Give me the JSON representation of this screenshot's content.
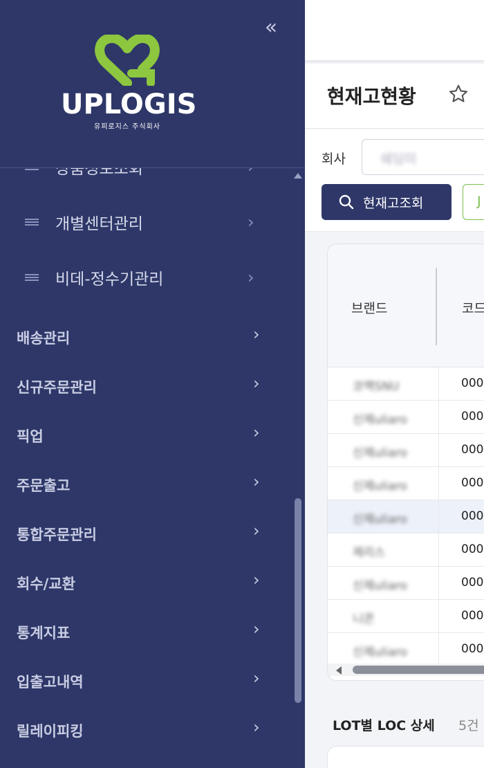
{
  "sidebar": {
    "collapse_icon": "double-chevron-left-icon",
    "logo": {
      "text": "UPLOGIS",
      "subtext": "유피로지스 주식회사"
    },
    "sub_items": [
      {
        "label": "상품정보조회"
      },
      {
        "label": "개별센터관리"
      },
      {
        "label": "비데-정수기관리"
      }
    ],
    "main_items": [
      {
        "label": "배송관리"
      },
      {
        "label": "신규주문관리"
      },
      {
        "label": "픽업"
      },
      {
        "label": "주문출고"
      },
      {
        "label": "통합주문관리"
      },
      {
        "label": "회수/교환"
      },
      {
        "label": "통계지표"
      },
      {
        "label": "입출고내역"
      },
      {
        "label": "릴레이피킹"
      }
    ],
    "colors": {
      "background": "#2e3768",
      "logo_green": "#8dc63f"
    }
  },
  "page": {
    "title": "현재고현황",
    "favorite_icon": "star-outline-icon"
  },
  "filter": {
    "company_label": "회사",
    "company_value": "쉐딩미",
    "search_button": "현재고조회",
    "second_button": "J"
  },
  "grid": {
    "columns": [
      "브랜드",
      "코드"
    ],
    "rows": [
      {
        "brand": "코맥SNU",
        "code": "000"
      },
      {
        "brand": "신제uliaro",
        "code": "000"
      },
      {
        "brand": "신제uliaro",
        "code": "000"
      },
      {
        "brand": "신제uliaro",
        "code": "000"
      },
      {
        "brand": "신제uliaro",
        "code": "000"
      },
      {
        "brand": "제리스",
        "code": "000"
      },
      {
        "brand": "신제uliaro",
        "code": "000"
      },
      {
        "brand": "니콘",
        "code": "000"
      },
      {
        "brand": "신제uliaro",
        "code": "000"
      }
    ]
  },
  "lot": {
    "title": "LOT별 LOC 상세",
    "count": "5건"
  }
}
